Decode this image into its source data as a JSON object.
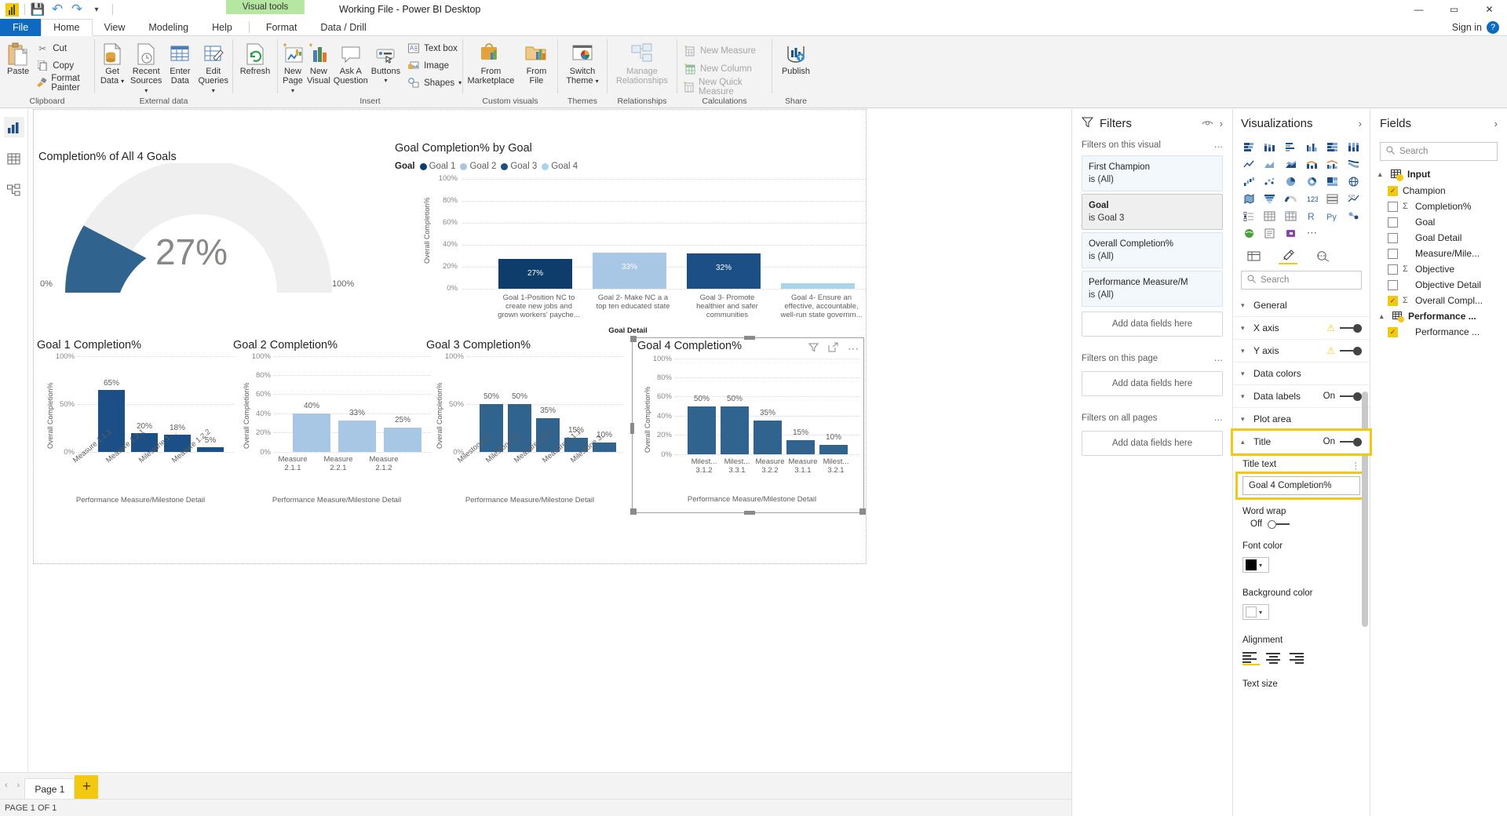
{
  "window": {
    "title": "Working File - Power BI Desktop",
    "visual_tools_label": "Visual tools",
    "minimize": "—",
    "maximize": "▭",
    "close": "✕",
    "sign_in": "Sign in",
    "help": "?"
  },
  "quick_access": [
    {
      "name": "powerbi-logo-icon",
      "glyph": ""
    },
    {
      "name": "save-icon",
      "glyph": "💾"
    },
    {
      "name": "undo-icon",
      "glyph": "↶"
    },
    {
      "name": "redo-icon",
      "glyph": "↷"
    },
    {
      "name": "customize-qat-icon",
      "glyph": "▾"
    }
  ],
  "ribbon_tabs": [
    {
      "label": "File",
      "active": false,
      "file": true
    },
    {
      "label": "Home",
      "active": true,
      "file": false
    },
    {
      "label": "View",
      "active": false,
      "file": false
    },
    {
      "label": "Modeling",
      "active": false,
      "file": false
    },
    {
      "label": "Help",
      "active": false,
      "file": false
    },
    {
      "label": "Format",
      "active": false,
      "file": false
    },
    {
      "label": "Data / Drill",
      "active": false,
      "file": false
    }
  ],
  "ribbon": {
    "clipboard": {
      "group_label": "Clipboard",
      "paste": "Paste",
      "cut": "Cut",
      "copy": "Copy",
      "format_painter": "Format Painter"
    },
    "external_data": {
      "group_label": "External data",
      "get_data": "Get\nData",
      "get_data_l1": "Get",
      "get_data_l2": "Data",
      "recent_sources_l1": "Recent",
      "recent_sources_l2": "Sources",
      "enter_data_l1": "Enter",
      "enter_data_l2": "Data",
      "edit_queries_l1": "Edit",
      "edit_queries_l2": "Queries",
      "refresh": "Refresh"
    },
    "insert": {
      "group_label": "Insert",
      "new_page_l1": "New",
      "new_page_l2": "Page",
      "new_visual_l1": "New",
      "new_visual_l2": "Visual",
      "ask_question_l1": "Ask A",
      "ask_question_l2": "Question",
      "buttons": "Buttons",
      "text_box": "Text box",
      "image": "Image",
      "shapes": "Shapes"
    },
    "custom_visuals": {
      "group_label": "Custom visuals",
      "from_marketplace_l1": "From",
      "from_marketplace_l2": "Marketplace",
      "from_file_l1": "From",
      "from_file_l2": "File"
    },
    "themes": {
      "group_label": "Themes",
      "switch_theme_l1": "Switch",
      "switch_theme_l2": "Theme"
    },
    "relationships": {
      "group_label": "Relationships",
      "manage_l1": "Manage",
      "manage_l2": "Relationships"
    },
    "calculations": {
      "group_label": "Calculations",
      "new_measure": "New Measure",
      "new_column": "New Column",
      "new_quick_measure": "New Quick Measure"
    },
    "share": {
      "group_label": "Share",
      "publish": "Publish"
    }
  },
  "left_rail": [
    {
      "name": "report-view-icon",
      "active": true
    },
    {
      "name": "data-view-icon",
      "active": false
    },
    {
      "name": "model-view-icon",
      "active": false
    }
  ],
  "chart_data": [
    {
      "type": "gauge",
      "name": "completion-gauge",
      "title": "Completion% of All 4 Goals",
      "value": 27,
      "value_label": "27%",
      "min_label": "0%",
      "max_label": "100%",
      "min": 0,
      "max": 100,
      "arc_color": "#31638F",
      "track_color": "#EFEFEF"
    },
    {
      "type": "bar",
      "name": "goal-completion-by-goal",
      "title": "Goal Completion% by Goal",
      "legend_title": "Goal",
      "legend": [
        {
          "label": "Goal 1",
          "color": "#0E3D6B"
        },
        {
          "label": "Goal 2",
          "color": "#A7C7E4"
        },
        {
          "label": "Goal 3",
          "color": "#1B4F86"
        },
        {
          "label": "Goal 4",
          "color": "#A9D5EC"
        }
      ],
      "categories": [
        "Goal 1-Position NC to create new jobs and grown workers' payche...",
        "Goal 2- Make NC a a top ten educated state",
        "Goal 3- Promote healthier and safer communities",
        "Goal 4- Ensure an effective, accountable, well-run state governm..."
      ],
      "values": [
        27,
        33,
        32,
        5
      ],
      "value_labels": [
        "27%",
        "33%",
        "32%",
        ""
      ],
      "colors": [
        "#0E3D6B",
        "#A7C7E4",
        "#1B4F86",
        "#A9D5EC"
      ],
      "ylabel": "Overall Completion%",
      "xlabel": "Goal Detail",
      "yticks": [
        "0%",
        "20%",
        "40%",
        "60%",
        "80%",
        "100%"
      ],
      "ylim": [
        0,
        100
      ],
      "grid": true
    },
    {
      "type": "bar",
      "name": "goal-1-completion",
      "title": "Goal 1 Completion%",
      "categories": [
        "Measure 1.1.1",
        "Measure 1.2.1",
        "Milestone 1....",
        "Measure 1.2.2"
      ],
      "values": [
        65,
        20,
        18,
        5
      ],
      "value_labels": [
        "65%",
        "20%",
        "18%",
        "5%"
      ],
      "ylabel": "Overall Completion%",
      "xlabel": "Performance Measure/Milestone Detail",
      "yticks": [
        "0%",
        "50%",
        "100%"
      ],
      "ylim": [
        0,
        100
      ],
      "color": "#31638F",
      "grid": true
    },
    {
      "type": "bar",
      "name": "goal-2-completion",
      "title": "Goal 2 Completion%",
      "categories": [
        "Measure 2.1.1",
        "Measure 2.2.1",
        "Measure 2.1.2"
      ],
      "values": [
        40,
        33,
        25
      ],
      "value_labels": [
        "40%",
        "33%",
        "25%"
      ],
      "ylabel": "Overall Completion%",
      "xlabel": "Performance Measure/Milestone Detail",
      "yticks": [
        "0%",
        "20%",
        "40%",
        "60%",
        "80%",
        "100%"
      ],
      "ylim": [
        0,
        100
      ],
      "color": "#A7C7E4",
      "grid": true
    },
    {
      "type": "bar",
      "name": "goal-3-completion",
      "title": "Goal 3 Completion%",
      "categories": [
        "Milestone 3...",
        "Milestone 3...",
        "Measure 3.2.2",
        "Measure 3.1.1",
        "Milestone 3..."
      ],
      "values": [
        50,
        50,
        35,
        15,
        10
      ],
      "value_labels": [
        "50%",
        "50%",
        "35%",
        "15%",
        "10%"
      ],
      "ylabel": "Overall Completion%",
      "xlabel": "Performance Measure/Milestone Detail",
      "yticks": [
        "0%",
        "50%",
        "100%"
      ],
      "ylim": [
        0,
        100
      ],
      "color": "#31638F",
      "grid": true
    },
    {
      "type": "bar",
      "name": "goal-4-completion",
      "title": "Goal 4 Completion%",
      "categories": [
        "Milest... 3.1.2",
        "Milest... 3.3.1",
        "Measure 3.2.2",
        "Measure 3.1.1",
        "Milest... 3.2.1"
      ],
      "values": [
        50,
        50,
        35,
        15,
        10
      ],
      "value_labels": [
        "50%",
        "50%",
        "35%",
        "15%",
        "10%"
      ],
      "ylabel": "Overall Completion%",
      "xlabel": "Performance Measure/Milestone Detail",
      "yticks": [
        "0%",
        "20%",
        "40%",
        "60%",
        "80%",
        "100%"
      ],
      "ylim": [
        0,
        100
      ],
      "color": "#31638F",
      "grid": true,
      "selected": true,
      "header_icons": [
        "filter-icon",
        "focus-mode-icon",
        "more-options-icon"
      ]
    }
  ],
  "page_tabs": {
    "prev": "‹",
    "next": "›",
    "tabs": [
      {
        "label": "Page 1",
        "active": true
      }
    ],
    "add_label": "+"
  },
  "status": {
    "text": "PAGE 1 OF 1"
  },
  "filters": {
    "title": "Filters",
    "icons": {
      "filter": "filter-icon",
      "eye": "eye-icon",
      "expand": "chevron-right-icon"
    },
    "sections": [
      {
        "label": "Filters on this visual",
        "more": "…",
        "cards": [
          {
            "name": "First Champion",
            "value": "is (All)",
            "active": false
          },
          {
            "name": "Goal",
            "value": "is Goal 3",
            "active": true
          },
          {
            "name": "Overall Completion%",
            "value": "is (All)",
            "active": false
          },
          {
            "name": "Performance Measure/M",
            "value": "is (All)",
            "active": false
          }
        ],
        "drop": "Add data fields here"
      },
      {
        "label": "Filters on this page",
        "more": "…",
        "cards": [],
        "drop": "Add data fields here"
      },
      {
        "label": "Filters on all pages",
        "more": "…",
        "cards": [],
        "drop": "Add data fields here"
      }
    ]
  },
  "visualizations": {
    "title": "Visualizations",
    "expand_icon": "chevron-right-icon",
    "gallery_rows": [
      [
        "stacked-bar-chart-icon",
        "stacked-column-chart-icon",
        "clustered-bar-chart-icon",
        "clustered-column-chart-icon",
        "100-stacked-bar-icon",
        "100-stacked-column-icon"
      ],
      [
        "line-chart-icon",
        "area-chart-icon",
        "stacked-area-chart-icon",
        "line-stacked-column-icon",
        "line-clustered-column-icon",
        "ribbon-chart-icon"
      ],
      [
        "waterfall-chart-icon",
        "scatter-chart-icon",
        "pie-chart-icon",
        "donut-chart-icon",
        "treemap-icon",
        "map-icon"
      ],
      [
        "filled-map-icon",
        "funnel-icon",
        "gauge-icon",
        "card-icon",
        "multi-row-card-icon",
        "kpi-icon"
      ],
      [
        "slicer-icon",
        "table-icon",
        "matrix-icon",
        "r-script-icon",
        "py-visual-icon",
        "key-influencers-icon"
      ],
      [
        "arcgis-map-icon",
        "paginated-report-icon",
        "powerapps-icon",
        "more-visuals-icon"
      ]
    ],
    "tabs": [
      {
        "name": "fields-tab-icon",
        "selected": false
      },
      {
        "name": "format-tab-icon",
        "selected": true
      },
      {
        "name": "analytics-tab-icon",
        "selected": false
      }
    ],
    "search_placeholder": "Search",
    "format_rows": [
      {
        "label": "General",
        "toggle": null,
        "warn": false,
        "expanded": false
      },
      {
        "label": "X axis",
        "toggle": "on",
        "warn": true,
        "expanded": false
      },
      {
        "label": "Y axis",
        "toggle": "on",
        "warn": true,
        "expanded": false
      },
      {
        "label": "Data colors",
        "toggle": null,
        "warn": false,
        "expanded": false
      },
      {
        "label": "Data labels",
        "toggle": "on",
        "toggle_label": "On",
        "warn": false,
        "expanded": false
      },
      {
        "label": "Plot area",
        "toggle": null,
        "warn": false,
        "expanded": false
      },
      {
        "label": "Title",
        "toggle": "on",
        "toggle_label": "On",
        "warn": false,
        "expanded": true,
        "highlight": true
      }
    ],
    "title_section": {
      "title_text_label": "Title text",
      "title_text_value": "Goal 4 Completion%",
      "word_wrap_label": "Word wrap",
      "word_wrap_state": "Off",
      "font_color_label": "Font color",
      "font_color_value": "#000000",
      "background_color_label": "Background color",
      "background_color_value": "#FFFFFF",
      "alignment_label": "Alignment",
      "text_size_label": "Text size"
    }
  },
  "fields": {
    "title": "Fields",
    "expand_icon": "chevron-right-icon",
    "search_placeholder": "Search",
    "tables": [
      {
        "name": "Input",
        "expanded": true,
        "checked": true,
        "items": [
          {
            "label": "Champion",
            "checked": true,
            "measure": false
          },
          {
            "label": "Completion%",
            "checked": false,
            "measure": true
          },
          {
            "label": "Goal",
            "checked": false,
            "measure": false
          },
          {
            "label": "Goal Detail",
            "checked": false,
            "measure": false
          },
          {
            "label": "Measure/Mile...",
            "checked": false,
            "measure": false
          },
          {
            "label": "Objective",
            "checked": false,
            "measure": true
          },
          {
            "label": "Objective Detail",
            "checked": false,
            "measure": false
          },
          {
            "label": "Overall Compl...",
            "checked": true,
            "measure": true
          },
          {
            "label": "Performance ...",
            "checked": false,
            "measure": false,
            "subtable": true
          }
        ]
      },
      {
        "name": "Performance ...",
        "expanded": true,
        "checked": true,
        "items": [
          {
            "label": "Performance ...",
            "checked": true,
            "measure": false
          }
        ]
      }
    ]
  }
}
